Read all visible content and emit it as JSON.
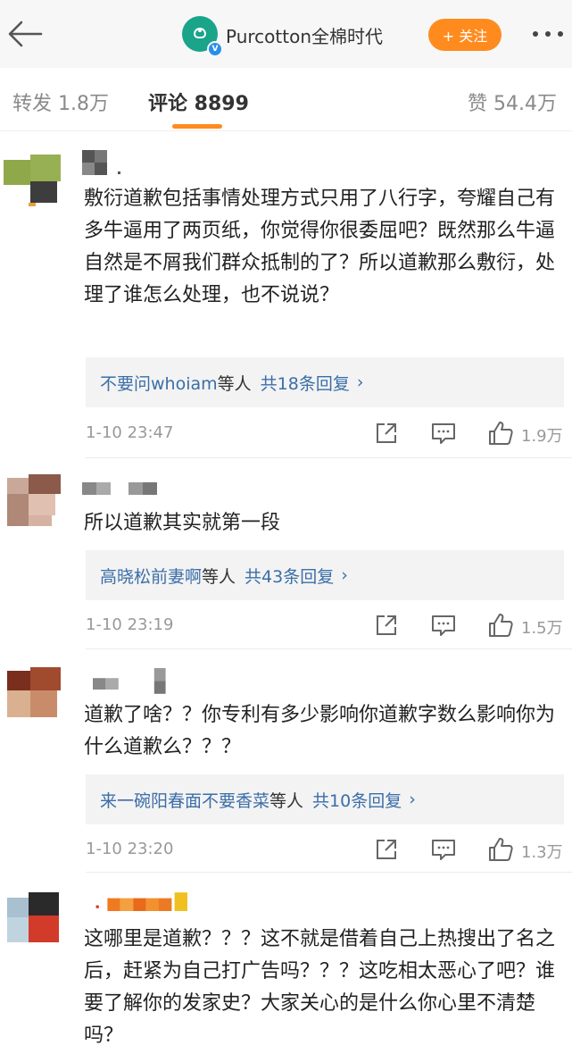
{
  "header": {
    "account_name": "Purcotton全棉时代",
    "logo_text": "Purcotton",
    "logo_subtext": "全棉时代",
    "follow_label": "+ 关注",
    "accent_color": "#ff8b1f"
  },
  "tabs": [
    {
      "label": "转发 1.8万"
    },
    {
      "label": "评论 8899"
    },
    {
      "label": "赞 54.4万"
    }
  ],
  "comments": [
    {
      "text": "敷衍道歉包括事情处理方式只用了八行字，夸耀自己有多牛逼用了两页纸，你觉得你很委屈吧？既然那么牛逼自然是不屑我们群众抵制的了？所以道歉那么敷衍，处理了谁怎么处理，也不说说？",
      "reply_names": "不要问whoiam",
      "reply_suffix": "等人",
      "reply_count": "共18条回复",
      "timestamp": "1-10 23:47",
      "likes": "1.9万"
    },
    {
      "text": "所以道歉其实就第一段",
      "reply_names": "高晓松前妻啊",
      "reply_suffix": "等人",
      "reply_count": "共43条回复",
      "timestamp": "1-10 23:19",
      "likes": "1.5万"
    },
    {
      "text": "道歉了啥？？你专利有多少影响你道歉字数么影响你为什么道歉么？？？",
      "reply_names": "来一碗阳春面不要香菜",
      "reply_suffix": "等人",
      "reply_count": "共10条回复",
      "timestamp": "1-10 23:20",
      "likes": "1.3万"
    },
    {
      "text": "这哪里是道歉？？？这不就是借着自己上热搜出了名之后，赶紧为自己打广告吗？？？这吃相太恶心了吧？谁要了解你的发家史？大家关心的是什么你心里不清楚吗？"
    }
  ]
}
